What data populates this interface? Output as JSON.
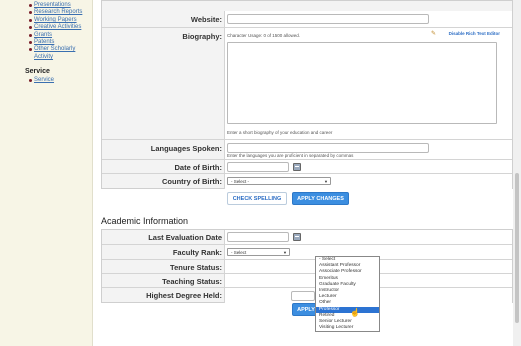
{
  "sidebar": {
    "items": [
      "Presentations",
      "Research Reports",
      "Working Papers",
      "Creative Activities",
      "Grants",
      "Patents",
      "Other Scholarly Activity"
    ],
    "section": "Service",
    "service_items": [
      "Service"
    ]
  },
  "profile": {
    "website_label": "Website:",
    "biography_label": "Biography:",
    "char_usage": "Character Usage: 0 of 1500 allowed.",
    "disable_rte": "Disable Rich Text Editor",
    "bio_hint": "Enter a short biography of your education and career",
    "languages_label": "Languages Spoken:",
    "languages_hint": "Enter the languages you are proficient in separated by commas",
    "dob_label": "Date of Birth:",
    "cob_label": "Country of Birth:",
    "cob_value": "- Select -"
  },
  "buttons": {
    "check_spelling": "CHECK SPELLING",
    "apply_changes": "APPLY CHANGES"
  },
  "academic": {
    "heading": "Academic Information",
    "last_eval_label": "Last Evaluation Date",
    "faculty_rank_label": "Faculty Rank:",
    "faculty_rank_value": "- Select",
    "tenure_label": "Tenure Status:",
    "teaching_label": "Teaching Status:",
    "degree_label": "Highest Degree Held:"
  },
  "rank_options": [
    "- Select",
    "Assistant Professor",
    "Associate Professor",
    "Emeritus",
    "Graduate Faculty",
    "Instructor",
    "Lecturer",
    "Other",
    "Professor",
    "Retired",
    "Senior Lecturer",
    "Visiting Lecturer"
  ],
  "rank_highlighted": "Professor"
}
